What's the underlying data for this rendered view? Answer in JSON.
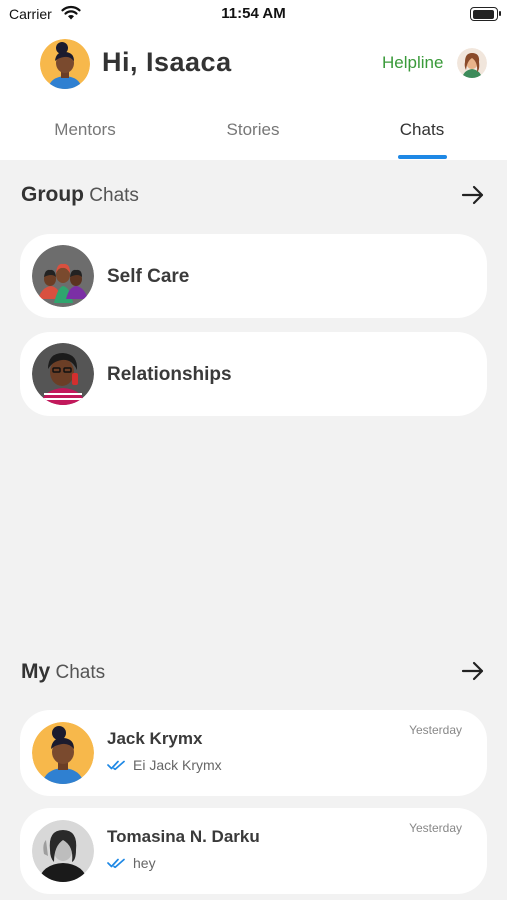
{
  "status_bar": {
    "carrier": "Carrier",
    "time": "11:54 AM"
  },
  "header": {
    "greeting": "Hi, Isaaca",
    "helpline": "Helpline"
  },
  "tabs": [
    {
      "label": "Mentors",
      "active": false
    },
    {
      "label": "Stories",
      "active": false
    },
    {
      "label": "Chats",
      "active": true
    }
  ],
  "group_chats": {
    "title_bold": "Group",
    "title_rest": "Chats",
    "items": [
      {
        "name": "Self Care"
      },
      {
        "name": "Relationships"
      }
    ]
  },
  "my_chats": {
    "title_bold": "My",
    "title_rest": "Chats",
    "items": [
      {
        "name": "Jack Krymx",
        "preview": "Ei Jack Krymx",
        "time": "Yesterday"
      },
      {
        "name": "Tomasina N. Darku",
        "preview": "hey",
        "time": "Yesterday"
      }
    ]
  },
  "colors": {
    "accent": "#1e88e5",
    "helpline": "#3a9a3a",
    "background": "#f2f2f2"
  },
  "icons": [
    "wifi-icon",
    "battery-icon",
    "arrow-right-icon",
    "double-check-icon"
  ]
}
